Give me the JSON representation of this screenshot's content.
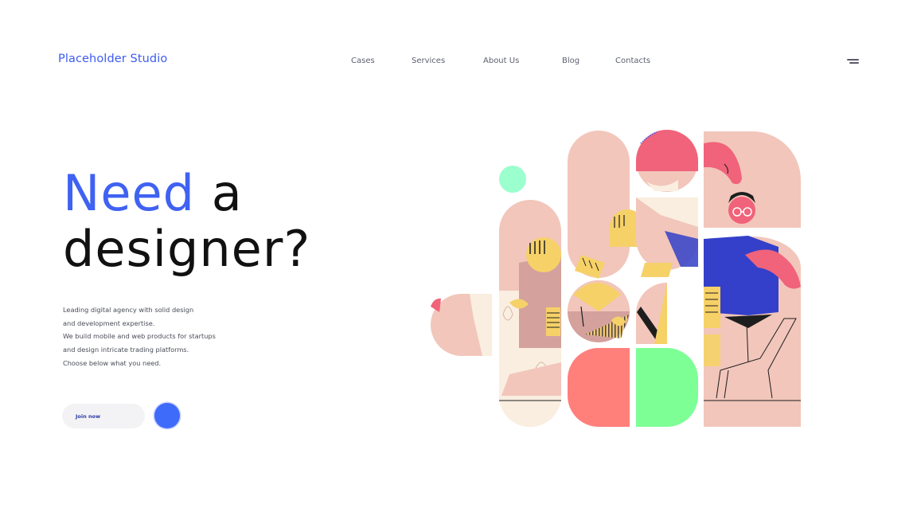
{
  "header": {
    "logo": "Placeholder Studio",
    "nav": [
      "Cases",
      "Services",
      "About Us",
      "Blog",
      "Contacts"
    ]
  },
  "hero": {
    "headline_accent": "Need",
    "headline_rest_1": " a",
    "headline_rest_2": "designer?",
    "description": [
      "Leading digital agency with solid design",
      "and development expertise.",
      "We build mobile and web products for startups",
      "and design intricate trading platforms.",
      "Choose below what you need."
    ],
    "cta_label": "Join now"
  },
  "colors": {
    "accent": "#3f62f2",
    "button_blue": "#3f6bfb",
    "tile_pink": "#f2c6bb",
    "tile_coral": "#ff7f7b",
    "tile_green": "#7dff96",
    "mint": "#9bffce"
  },
  "icons": {
    "menu": "hamburger-menu-icon"
  }
}
